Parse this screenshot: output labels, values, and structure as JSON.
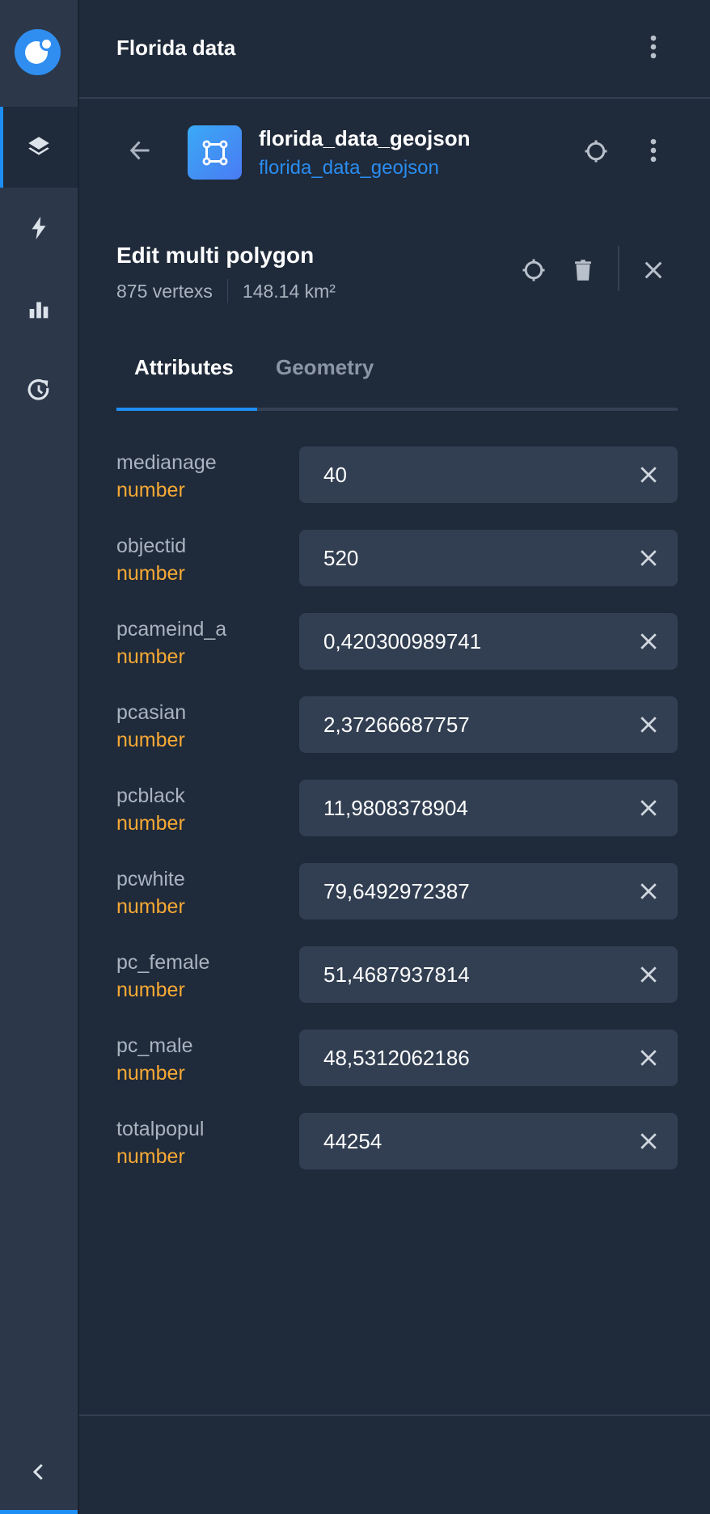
{
  "sidebar": {
    "logo": "app-logo",
    "items": [
      {
        "id": "layers",
        "icon": "layers-icon",
        "active": true
      },
      {
        "id": "analysis",
        "icon": "lightning-icon",
        "active": false
      },
      {
        "id": "widgets",
        "icon": "bar-chart-icon",
        "active": false
      },
      {
        "id": "history",
        "icon": "history-icon",
        "active": false
      }
    ],
    "collapse_icon": "chevron-left-icon"
  },
  "header": {
    "title": "Florida data",
    "menu_icon": "more-vertical-icon"
  },
  "layer": {
    "name": "florida_data_geojson",
    "source": "florida_data_geojson",
    "icon": "polygon-icon",
    "back_icon": "arrow-left-icon",
    "locate_icon": "crosshair-icon",
    "menu_icon": "more-vertical-icon"
  },
  "edit": {
    "title": "Edit multi polygon",
    "vertices": "875 vertexs",
    "area": "148.14 km²",
    "actions": [
      "crosshair-icon",
      "trash-icon",
      "close-icon"
    ]
  },
  "tabs": [
    {
      "label": "Attributes",
      "active": true
    },
    {
      "label": "Geometry",
      "active": false
    }
  ],
  "attributes": [
    {
      "name": "medianage",
      "type": "number",
      "value": "40"
    },
    {
      "name": "objectid",
      "type": "number",
      "value": "520"
    },
    {
      "name": "pcameind_a",
      "type": "number",
      "value": "0,420300989741"
    },
    {
      "name": "pcasian",
      "type": "number",
      "value": "2,37266687757"
    },
    {
      "name": "pcblack",
      "type": "number",
      "value": "11,9808378904"
    },
    {
      "name": "pcwhite",
      "type": "number",
      "value": "79,6492972387"
    },
    {
      "name": "pc_female",
      "type": "number",
      "value": "51,4687937814"
    },
    {
      "name": "pc_male",
      "type": "number",
      "value": "48,5312062186"
    },
    {
      "name": "totalpopul",
      "type": "number",
      "value": "44254"
    }
  ],
  "colors": {
    "accent": "#1e8ef4",
    "type_label": "#f6a935",
    "background": "#1f2a3a",
    "sidebar": "#2c3749",
    "input": "#323f52"
  }
}
